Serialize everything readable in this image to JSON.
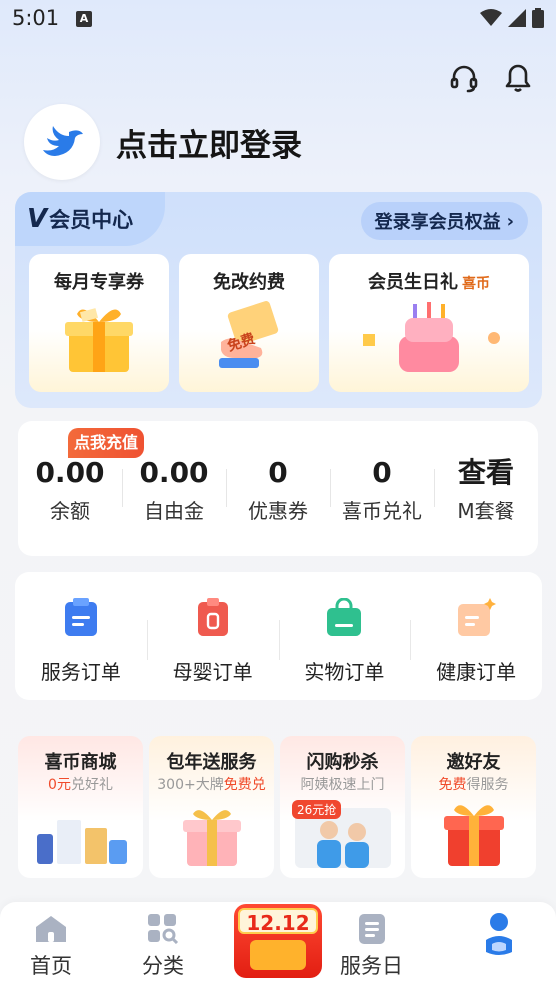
{
  "status_bar": {
    "time": "5:01",
    "notification_glyph": "A"
  },
  "header": {
    "icons": [
      "headset-icon",
      "bell-icon"
    ],
    "login_text": "点击立即登录"
  },
  "vip": {
    "logo": "V",
    "title": "会员中心",
    "benefit_button": "登录享会员权益",
    "items": [
      {
        "title": "每月专享券"
      },
      {
        "title": "免改约费",
        "badge_text": "免费"
      },
      {
        "title": "会员生日礼",
        "tag": "喜币"
      }
    ]
  },
  "wallet": {
    "recharge_tag": "点我充值",
    "items": [
      {
        "value": "0.00",
        "label": "余额"
      },
      {
        "value": "0.00",
        "label": "自由金"
      },
      {
        "value": "0",
        "label": "优惠券"
      },
      {
        "value": "0",
        "label": "喜币兑礼"
      },
      {
        "value": "查看",
        "label": "M套餐"
      }
    ]
  },
  "orders": [
    {
      "label": "服务订单",
      "color": "#3e7cf0"
    },
    {
      "label": "母婴订单",
      "color": "#ef5a4f"
    },
    {
      "label": "实物订单",
      "color": "#2fc08f"
    },
    {
      "label": "健康订单",
      "color": "#ffbd8a"
    }
  ],
  "promos": [
    {
      "title": "喜币商城",
      "sub_hl": "0元",
      "sub_rest": "兑好礼"
    },
    {
      "title": "包年送服务",
      "sub_pre": "300+大牌",
      "sub_hl": "免费兑"
    },
    {
      "title": "闪购秒杀",
      "sub_rest": "阿姨极速上门",
      "badge": "26元抢"
    },
    {
      "title": "邀好友",
      "sub_hl": "免费",
      "sub_rest": "得服务"
    }
  ],
  "tabbar": {
    "items": [
      {
        "label": "首页"
      },
      {
        "label": "分类"
      },
      {
        "label": "服务日"
      }
    ],
    "center_label": "12.12"
  },
  "colors": {
    "accent": "#14284e",
    "promo_red": "#f04b2b",
    "vip_bg": "#cfe0fb"
  }
}
